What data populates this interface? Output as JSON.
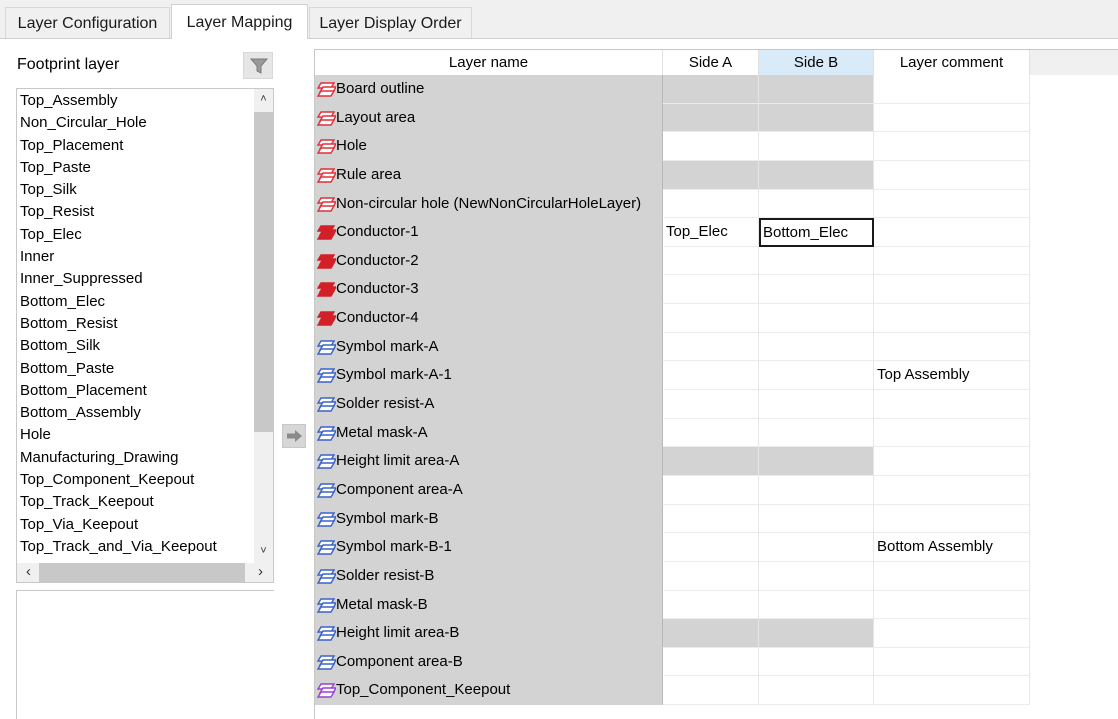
{
  "tabs": [
    {
      "label": "Layer Configuration",
      "active": false
    },
    {
      "label": "Layer Mapping",
      "active": true
    },
    {
      "label": "Layer Display Order",
      "active": false
    }
  ],
  "footprint": {
    "label": "Footprint layer",
    "filter_icon": "filter-icon",
    "items": [
      "Top_Assembly",
      "Non_Circular_Hole",
      "Top_Placement",
      "Top_Paste",
      "Top_Silk",
      "Top_Resist",
      "Top_Elec",
      "Inner",
      "Inner_Suppressed",
      "Bottom_Elec",
      "Bottom_Resist",
      "Bottom_Silk",
      "Bottom_Paste",
      "Bottom_Placement",
      "Bottom_Assembly",
      "Hole",
      "Manufacturing_Drawing",
      "Top_Component_Keepout",
      "Top_Track_Keepout",
      "Top_Via_Keepout",
      "Top_Track_and_Via_Keepout"
    ],
    "scroll_up": "˄",
    "scroll_down": "˅",
    "scroll_left": "‹",
    "scroll_right": "›"
  },
  "grid": {
    "headers": [
      "Layer name",
      "Side A",
      "Side B",
      "Layer comment"
    ],
    "selected_header_color": "#d9ebf9",
    "icon_colors": {
      "red": "#e0303a",
      "red_solid": "#d32028",
      "blue": "#3a63c8",
      "purple": "#9b3fd6"
    },
    "rows": [
      {
        "name": "Board outline",
        "icon": "red",
        "a": "",
        "b": "",
        "comment": "",
        "a_gray": true,
        "b_gray": true
      },
      {
        "name": "Layout area",
        "icon": "red",
        "a": "",
        "b": "",
        "comment": "",
        "a_gray": true,
        "b_gray": true
      },
      {
        "name": "Hole",
        "icon": "red",
        "a": "",
        "b": "",
        "comment": "",
        "a_gray": false,
        "b_gray": false
      },
      {
        "name": "Rule area",
        "icon": "red",
        "a": "",
        "b": "",
        "comment": "",
        "a_gray": true,
        "b_gray": true
      },
      {
        "name": "Non-circular hole (NewNonCircularHoleLayer)",
        "icon": "red",
        "a": "",
        "b": "",
        "comment": "",
        "a_gray": false,
        "b_gray": false
      },
      {
        "name": "Conductor-1",
        "icon": "red_solid",
        "a": "Top_Elec",
        "b": "Bottom_Elec",
        "comment": "",
        "a_gray": false,
        "b_gray": false,
        "b_selected": true
      },
      {
        "name": "Conductor-2",
        "icon": "red_solid",
        "a": "",
        "b": "",
        "comment": "",
        "a_gray": false,
        "b_gray": false
      },
      {
        "name": "Conductor-3",
        "icon": "red_solid",
        "a": "",
        "b": "",
        "comment": "",
        "a_gray": false,
        "b_gray": false
      },
      {
        "name": "Conductor-4",
        "icon": "red_solid",
        "a": "",
        "b": "",
        "comment": "",
        "a_gray": false,
        "b_gray": false
      },
      {
        "name": "Symbol mark-A",
        "icon": "blue",
        "a": "",
        "b": "",
        "comment": "",
        "a_gray": false,
        "b_gray": false
      },
      {
        "name": "Symbol mark-A-1",
        "icon": "blue",
        "a": "",
        "b": "",
        "comment": "Top Assembly",
        "a_gray": false,
        "b_gray": false
      },
      {
        "name": "Solder resist-A",
        "icon": "blue",
        "a": "",
        "b": "",
        "comment": "",
        "a_gray": false,
        "b_gray": false
      },
      {
        "name": "Metal mask-A",
        "icon": "blue",
        "a": "",
        "b": "",
        "comment": "",
        "a_gray": false,
        "b_gray": false
      },
      {
        "name": "Height limit area-A",
        "icon": "blue",
        "a": "",
        "b": "",
        "comment": "",
        "a_gray": true,
        "b_gray": true
      },
      {
        "name": "Component area-A",
        "icon": "blue",
        "a": "",
        "b": "",
        "comment": "",
        "a_gray": false,
        "b_gray": false
      },
      {
        "name": "Symbol mark-B",
        "icon": "blue",
        "a": "",
        "b": "",
        "comment": "",
        "a_gray": false,
        "b_gray": false
      },
      {
        "name": "Symbol mark-B-1",
        "icon": "blue",
        "a": "",
        "b": "",
        "comment": "Bottom Assembly",
        "a_gray": false,
        "b_gray": false
      },
      {
        "name": "Solder resist-B",
        "icon": "blue",
        "a": "",
        "b": "",
        "comment": "",
        "a_gray": false,
        "b_gray": false
      },
      {
        "name": "Metal mask-B",
        "icon": "blue",
        "a": "",
        "b": "",
        "comment": "",
        "a_gray": false,
        "b_gray": false
      },
      {
        "name": "Height limit area-B",
        "icon": "blue",
        "a": "",
        "b": "",
        "comment": "",
        "a_gray": true,
        "b_gray": true
      },
      {
        "name": "Component area-B",
        "icon": "blue",
        "a": "",
        "b": "",
        "comment": "",
        "a_gray": false,
        "b_gray": false
      },
      {
        "name": "Top_Component_Keepout",
        "icon": "purple",
        "a": "",
        "b": "",
        "comment": "",
        "a_gray": false,
        "b_gray": false
      }
    ]
  },
  "assign_button_icon": "arrow-right-icon"
}
